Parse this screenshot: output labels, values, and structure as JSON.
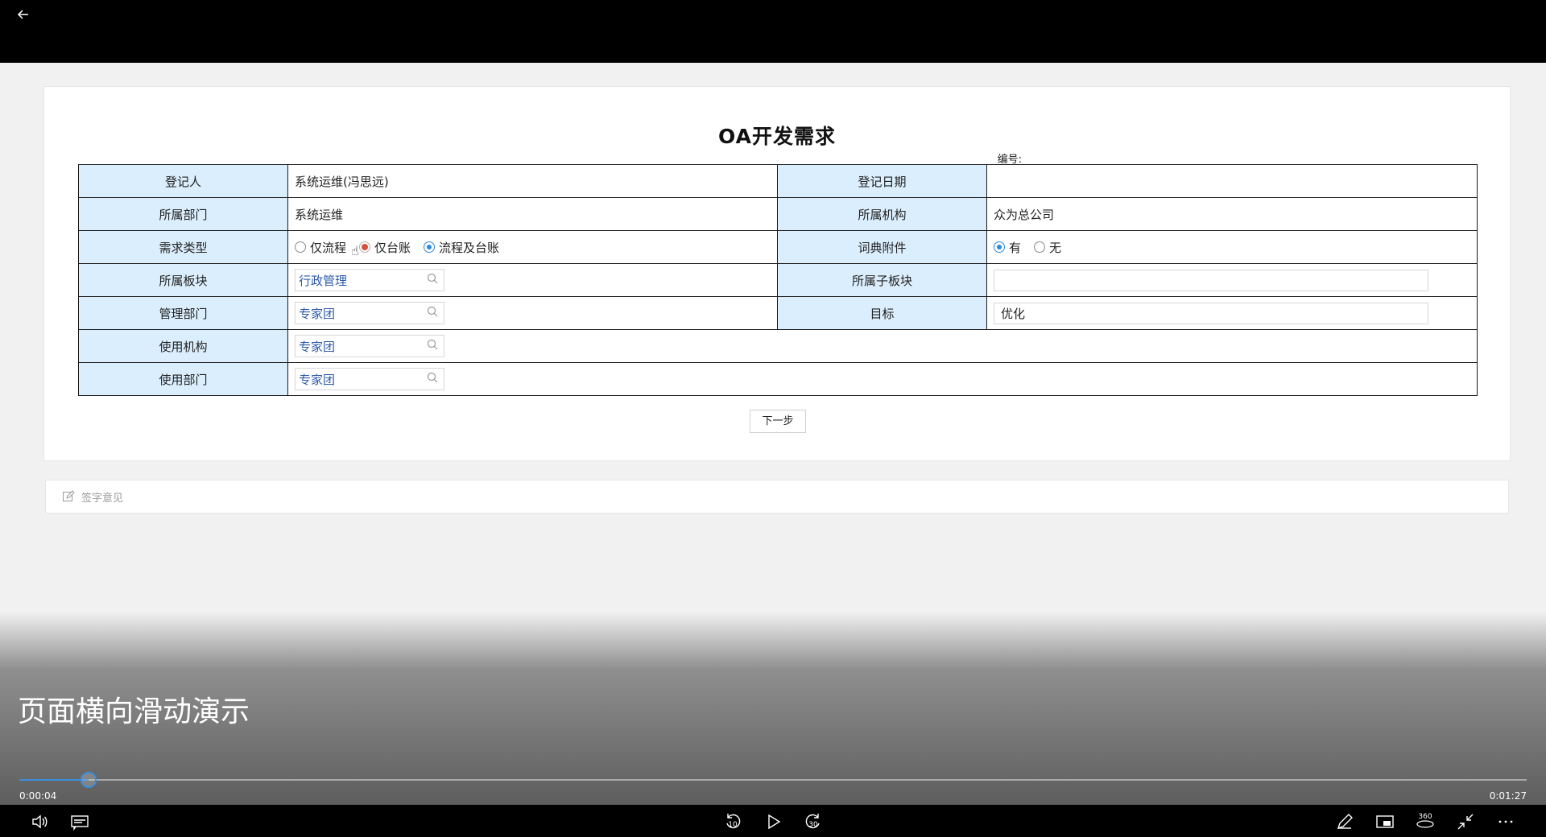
{
  "form": {
    "title": "OA开发需求",
    "serial_label": "编号:",
    "rows": {
      "registrant_label": "登记人",
      "registrant_value": "系统运维(冯思远)",
      "reg_date_label": "登记日期",
      "reg_date_value": "",
      "dept_label": "所属部门",
      "dept_value": "系统运维",
      "org_label": "所属机构",
      "org_value": "众为总公司",
      "req_type_label": "需求类型",
      "req_type_options": [
        "仅流程",
        "仅台账",
        "流程及台账"
      ],
      "req_type_selected": "流程及台账",
      "dict_label": "词典附件",
      "dict_options": [
        "有",
        "无"
      ],
      "dict_selected": "有",
      "block_label": "所属板块",
      "block_value": "行政管理",
      "subblock_label": "所属子板块",
      "subblock_value": "",
      "mgmt_dept_label": "管理部门",
      "mgmt_dept_value": "专家团",
      "target_label": "目标",
      "target_value": "优化",
      "use_org_label": "使用机构",
      "use_org_value": "专家团",
      "use_dept_label": "使用部门",
      "use_dept_value": "专家团"
    },
    "next_label": "下一步"
  },
  "sign": {
    "label": "签字意见"
  },
  "video": {
    "caption": "页面横向滑动演示",
    "current_time": "0:00:04",
    "total_time": "0:01:27",
    "progress_fraction": 0.046,
    "skip_back": "10",
    "skip_forward": "30",
    "vr_label": "360",
    "accent": "#3b8fe0"
  }
}
